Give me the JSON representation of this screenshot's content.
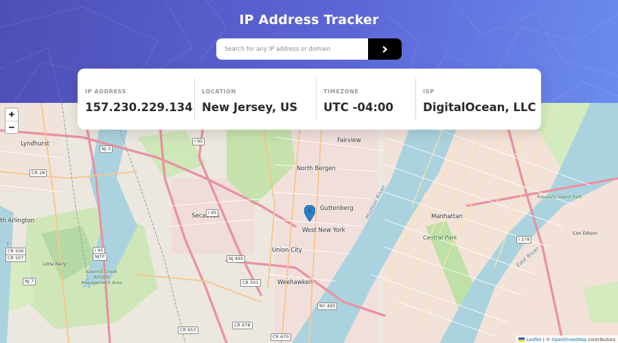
{
  "header": {
    "title": "IP Address Tracker",
    "search": {
      "placeholder": "Search for any IP address or domain",
      "value": ""
    },
    "submit_icon": "chevron-right-icon"
  },
  "info": [
    {
      "label": "IP ADDRESS",
      "value": "157.230.229.134"
    },
    {
      "label": "LOCATION",
      "value": "New Jersey, US"
    },
    {
      "label": "TIMEZONE",
      "value": "UTC -04:00"
    },
    {
      "label": "ISP",
      "value": "DigitalOcean, LLC"
    }
  ],
  "map": {
    "zoom_in": "+",
    "zoom_out": "−",
    "marker_icon": "location-pin-icon",
    "labels": {
      "lyndhurst": "Lyndhurst",
      "arlington": "th Arlington",
      "secaucus": "Secaucus",
      "north_bergen": "North Bergen",
      "fairview": "Fairview",
      "guttenberg": "Guttenberg",
      "west_new_york": "West New York",
      "union_city": "Union City",
      "weehawken": "Weehawken",
      "manhattan": "Manhattan",
      "central_park": "Central Park",
      "hudson_river": "Hudson River",
      "east_river": "East River",
      "con_edison": "Con Edison",
      "randalls": "Randalls Island Park",
      "mud_area": "Sawmill Creek Wildlife Management Area",
      "little_ferry": "Little Ferry",
      "seven": "7"
    },
    "shields": {
      "nj3": "NJ 3",
      "i95a": "I 95",
      "i95b": "I 95",
      "nj495": "NJ 495",
      "ny495": "NY 495",
      "cr501": "CR 501",
      "cr678": "CR 678",
      "cr653": "CR 653",
      "cr670": "CR 670",
      "cr28": "CR 28",
      "cr506": "CR 506",
      "cr507": "CR 507",
      "nj7": "NJ 7",
      "i278": "I 278",
      "njtp": "NJTP",
      "i95c": "I 95"
    }
  },
  "attribution": {
    "leaflet": "Leaflet",
    "separator": "| ©",
    "osm": "OpenStreetMap",
    "contributors": "contributors"
  },
  "colors": {
    "header_start": "#4e4fb6",
    "header_end": "#6b8cee",
    "water": "#aad3df",
    "park": "#c8e6b3",
    "urban": "#f2dedc",
    "button": "#000000"
  }
}
